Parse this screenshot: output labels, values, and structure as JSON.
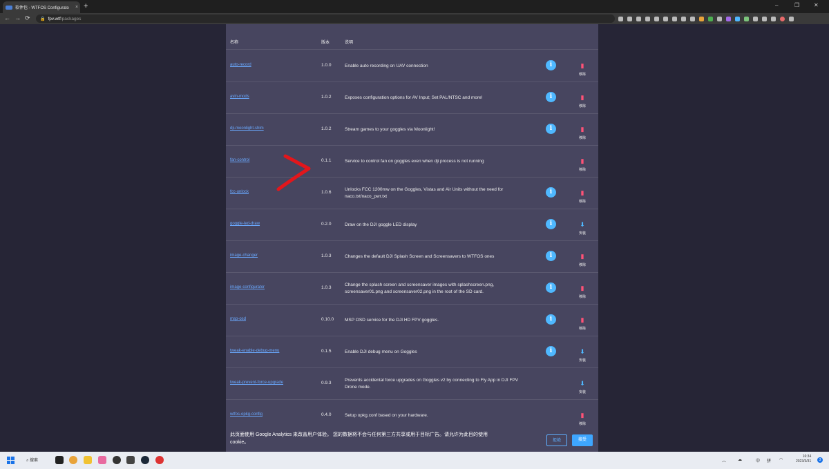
{
  "browser": {
    "tab_title": "软件包 - WTFOS Configurato",
    "tab_close": "×",
    "new_tab": "+",
    "url_host": "fpv.wtf",
    "url_path": "/packages",
    "win_min": "–",
    "win_max": "❐",
    "win_close": "✕",
    "back": "←",
    "forward": "→",
    "reload": "⟳"
  },
  "table": {
    "header_name": "名称",
    "header_version": "版本",
    "header_desc": "说明",
    "rows": [
      {
        "name": "auto-record",
        "version": "1.0.0",
        "desc": "Enable auto recording on UAV connection",
        "info": true,
        "action": "remove"
      },
      {
        "name": "avin-mods",
        "version": "1.0.2",
        "desc": "Exposes configuration options for AV Input; Set PAL/NTSC and more!",
        "info": true,
        "action": "remove"
      },
      {
        "name": "dji-moonlight-shim",
        "version": "1.0.2",
        "desc": "Stream games to your goggles via Moonlight!",
        "info": true,
        "action": "remove"
      },
      {
        "name": "fan-control",
        "version": "0.1.1",
        "desc": "Service to control fan on goggles even when dji process is not running",
        "info": false,
        "action": "remove"
      },
      {
        "name": "fcc-unlock",
        "version": "1.0.6",
        "desc": "Unlocks FCC 1200mw on the Goggles, Vistas and Air Units without the need for naco.txt/naco_pwr.txt",
        "info": true,
        "action": "remove"
      },
      {
        "name": "goggle-led-draw",
        "version": "0.2.0",
        "desc": "Draw on the DJI goggle LED display",
        "info": true,
        "action": "install"
      },
      {
        "name": "image-changer",
        "version": "1.0.3",
        "desc": "Changes the default DJI Splash Screen and Screensavers to WTFOS ones",
        "info": true,
        "action": "remove"
      },
      {
        "name": "image-configurator",
        "version": "1.0.3",
        "desc": "Change the splash screen and screensaver images with splashscreen.png, screensaver01.png and screensaver02.png in the root of the SD card.",
        "info": true,
        "action": "remove"
      },
      {
        "name": "msp-osd",
        "version": "0.10.0",
        "desc": "MSP OSD service for the DJI HD FPV goggles.",
        "info": true,
        "action": "remove"
      },
      {
        "name": "tweak-enable-debug-menu",
        "version": "0.1.5",
        "desc": "Enable DJI debug menu on Goggles",
        "info": true,
        "action": "install"
      },
      {
        "name": "tweak-prevent-force-upgrade",
        "version": "0.9.3",
        "desc": "Prevents accidental force upgrades on Goggles v2 by connecting to Fly App in DJI FPV Drone mode.",
        "info": false,
        "action": "install"
      },
      {
        "name": "wtfos-opkg-config",
        "version": "0.4.0",
        "desc": "Setup opkg.conf based on your hardware.",
        "info": false,
        "action": "remove"
      }
    ],
    "remove_label": "移除",
    "install_label": "安装",
    "info_glyph": "i",
    "remove_glyph": "▮",
    "install_glyph": "⬇"
  },
  "cookie_banner": {
    "text": "此页面使用 Google Analytics 来改善用户体验。 您的数据将不会与任何第三方共享或用于目标广告。请允许为此目的使用 cookie。",
    "reject_label": "拒绝",
    "accept_label": "接受"
  },
  "taskbar": {
    "search_label": "搜索",
    "tray_lang": "中",
    "tray_ime": "拼",
    "time": "16:34",
    "date": "2023/3/31",
    "notif_count": "3"
  },
  "colors": {
    "link": "#6aa9ff",
    "remove": "#ff5277",
    "install": "#4fb8ff",
    "annotation_arrow": "#e3161b"
  }
}
